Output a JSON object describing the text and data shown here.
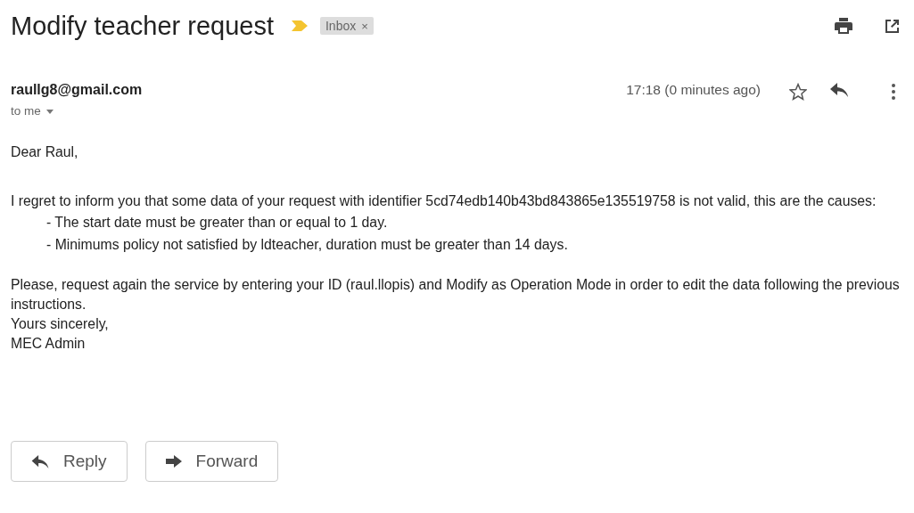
{
  "subject": "Modify teacher request",
  "important": true,
  "labels": [
    {
      "text": "Inbox",
      "remove": "×"
    }
  ],
  "sender": "raullg8@gmail.com",
  "recipient": "to me",
  "time": "17:18 (0 minutes ago)",
  "starred": false,
  "body": [
    {
      "kind": "line",
      "text": "Dear Raul,"
    },
    {
      "kind": "gap"
    },
    {
      "kind": "line",
      "text": "I regret to inform you that some data of your request with identifier 5cd74edb140b43bd843865e135519758 is not valid, this are the causes:"
    },
    {
      "kind": "item",
      "text": "- The start date must be greater than or equal to 1 day."
    },
    {
      "kind": "item",
      "text": "- Minimums policy not satisfied by ldteacher, duration must be greater than 14 days."
    },
    {
      "kind": "gap"
    },
    {
      "kind": "line",
      "text": "Please, request again the service by entering your ID (raul.llopis) and Modify as Operation Mode in order to edit the data following the previous instructions."
    },
    {
      "kind": "line",
      "text": "Yours sincerely,"
    },
    {
      "kind": "line",
      "text": "MEC Admin"
    }
  ],
  "actions": [
    {
      "kind": "reply",
      "label": "Reply"
    },
    {
      "kind": "forward",
      "label": "Forward"
    }
  ]
}
